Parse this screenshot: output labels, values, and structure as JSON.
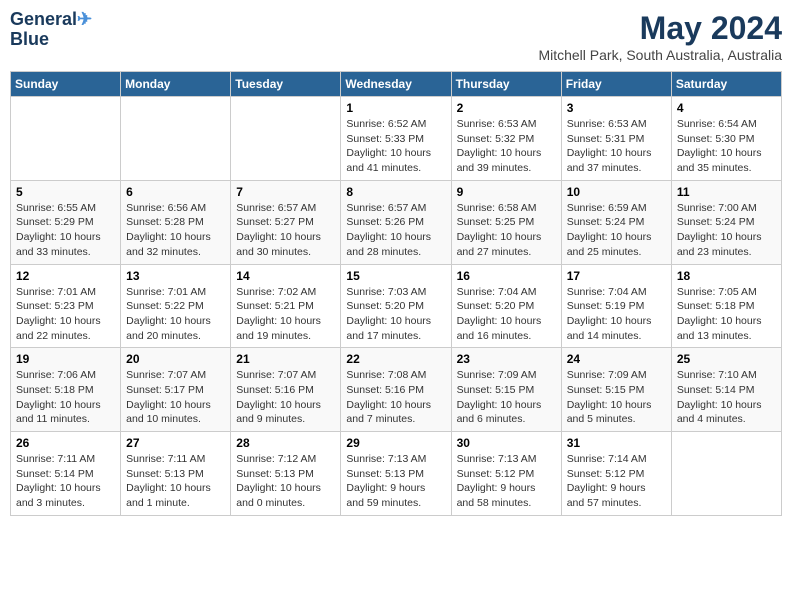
{
  "logo": {
    "line1": "General",
    "line2": "Blue"
  },
  "title": "May 2024",
  "subtitle": "Mitchell Park, South Australia, Australia",
  "days_header": [
    "Sunday",
    "Monday",
    "Tuesday",
    "Wednesday",
    "Thursday",
    "Friday",
    "Saturday"
  ],
  "weeks": [
    [
      {
        "day": "",
        "info": ""
      },
      {
        "day": "",
        "info": ""
      },
      {
        "day": "",
        "info": ""
      },
      {
        "day": "1",
        "info": "Sunrise: 6:52 AM\nSunset: 5:33 PM\nDaylight: 10 hours\nand 41 minutes."
      },
      {
        "day": "2",
        "info": "Sunrise: 6:53 AM\nSunset: 5:32 PM\nDaylight: 10 hours\nand 39 minutes."
      },
      {
        "day": "3",
        "info": "Sunrise: 6:53 AM\nSunset: 5:31 PM\nDaylight: 10 hours\nand 37 minutes."
      },
      {
        "day": "4",
        "info": "Sunrise: 6:54 AM\nSunset: 5:30 PM\nDaylight: 10 hours\nand 35 minutes."
      }
    ],
    [
      {
        "day": "5",
        "info": "Sunrise: 6:55 AM\nSunset: 5:29 PM\nDaylight: 10 hours\nand 33 minutes."
      },
      {
        "day": "6",
        "info": "Sunrise: 6:56 AM\nSunset: 5:28 PM\nDaylight: 10 hours\nand 32 minutes."
      },
      {
        "day": "7",
        "info": "Sunrise: 6:57 AM\nSunset: 5:27 PM\nDaylight: 10 hours\nand 30 minutes."
      },
      {
        "day": "8",
        "info": "Sunrise: 6:57 AM\nSunset: 5:26 PM\nDaylight: 10 hours\nand 28 minutes."
      },
      {
        "day": "9",
        "info": "Sunrise: 6:58 AM\nSunset: 5:25 PM\nDaylight: 10 hours\nand 27 minutes."
      },
      {
        "day": "10",
        "info": "Sunrise: 6:59 AM\nSunset: 5:24 PM\nDaylight: 10 hours\nand 25 minutes."
      },
      {
        "day": "11",
        "info": "Sunrise: 7:00 AM\nSunset: 5:24 PM\nDaylight: 10 hours\nand 23 minutes."
      }
    ],
    [
      {
        "day": "12",
        "info": "Sunrise: 7:01 AM\nSunset: 5:23 PM\nDaylight: 10 hours\nand 22 minutes."
      },
      {
        "day": "13",
        "info": "Sunrise: 7:01 AM\nSunset: 5:22 PM\nDaylight: 10 hours\nand 20 minutes."
      },
      {
        "day": "14",
        "info": "Sunrise: 7:02 AM\nSunset: 5:21 PM\nDaylight: 10 hours\nand 19 minutes."
      },
      {
        "day": "15",
        "info": "Sunrise: 7:03 AM\nSunset: 5:20 PM\nDaylight: 10 hours\nand 17 minutes."
      },
      {
        "day": "16",
        "info": "Sunrise: 7:04 AM\nSunset: 5:20 PM\nDaylight: 10 hours\nand 16 minutes."
      },
      {
        "day": "17",
        "info": "Sunrise: 7:04 AM\nSunset: 5:19 PM\nDaylight: 10 hours\nand 14 minutes."
      },
      {
        "day": "18",
        "info": "Sunrise: 7:05 AM\nSunset: 5:18 PM\nDaylight: 10 hours\nand 13 minutes."
      }
    ],
    [
      {
        "day": "19",
        "info": "Sunrise: 7:06 AM\nSunset: 5:18 PM\nDaylight: 10 hours\nand 11 minutes."
      },
      {
        "day": "20",
        "info": "Sunrise: 7:07 AM\nSunset: 5:17 PM\nDaylight: 10 hours\nand 10 minutes."
      },
      {
        "day": "21",
        "info": "Sunrise: 7:07 AM\nSunset: 5:16 PM\nDaylight: 10 hours\nand 9 minutes."
      },
      {
        "day": "22",
        "info": "Sunrise: 7:08 AM\nSunset: 5:16 PM\nDaylight: 10 hours\nand 7 minutes."
      },
      {
        "day": "23",
        "info": "Sunrise: 7:09 AM\nSunset: 5:15 PM\nDaylight: 10 hours\nand 6 minutes."
      },
      {
        "day": "24",
        "info": "Sunrise: 7:09 AM\nSunset: 5:15 PM\nDaylight: 10 hours\nand 5 minutes."
      },
      {
        "day": "25",
        "info": "Sunrise: 7:10 AM\nSunset: 5:14 PM\nDaylight: 10 hours\nand 4 minutes."
      }
    ],
    [
      {
        "day": "26",
        "info": "Sunrise: 7:11 AM\nSunset: 5:14 PM\nDaylight: 10 hours\nand 3 minutes."
      },
      {
        "day": "27",
        "info": "Sunrise: 7:11 AM\nSunset: 5:13 PM\nDaylight: 10 hours\nand 1 minute."
      },
      {
        "day": "28",
        "info": "Sunrise: 7:12 AM\nSunset: 5:13 PM\nDaylight: 10 hours\nand 0 minutes."
      },
      {
        "day": "29",
        "info": "Sunrise: 7:13 AM\nSunset: 5:13 PM\nDaylight: 9 hours\nand 59 minutes."
      },
      {
        "day": "30",
        "info": "Sunrise: 7:13 AM\nSunset: 5:12 PM\nDaylight: 9 hours\nand 58 minutes."
      },
      {
        "day": "31",
        "info": "Sunrise: 7:14 AM\nSunset: 5:12 PM\nDaylight: 9 hours\nand 57 minutes."
      },
      {
        "day": "",
        "info": ""
      }
    ]
  ]
}
